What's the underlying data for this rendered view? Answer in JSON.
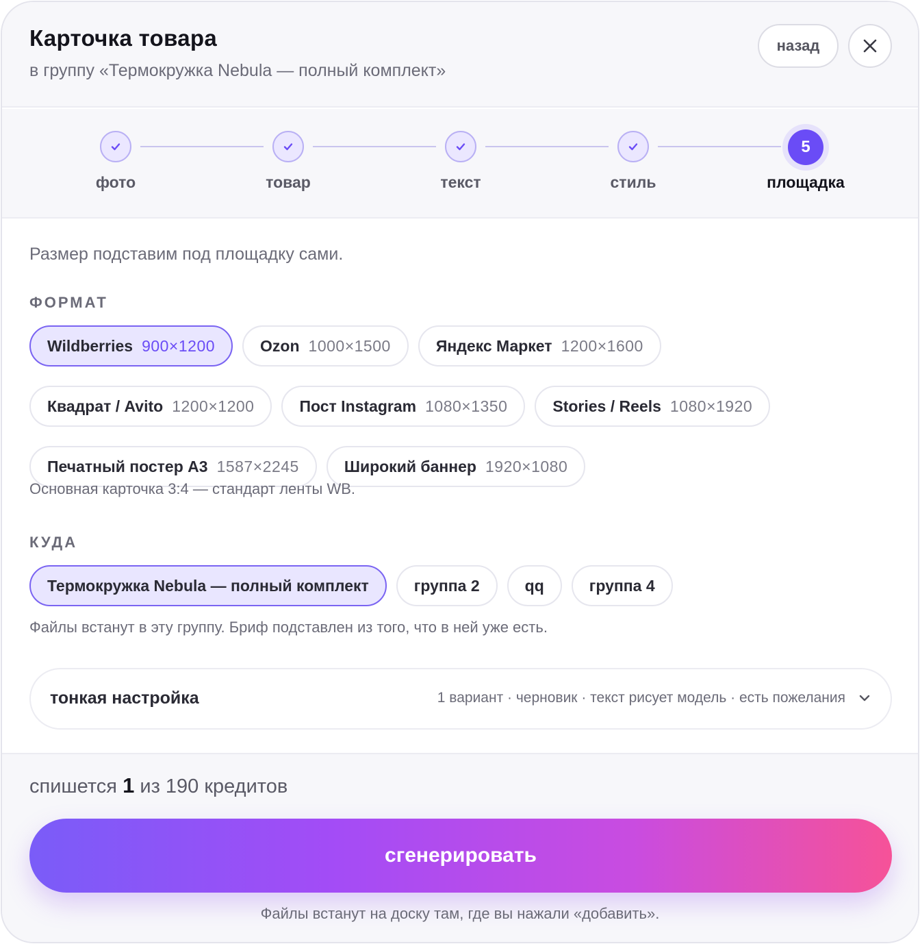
{
  "header": {
    "title": "Карточка товара",
    "subtitle": "в группу «Термокружка Nebula — полный комплект»",
    "back_label": "назад",
    "close_icon": "close-icon"
  },
  "stepper": {
    "steps": [
      {
        "label": "фото",
        "state": "done"
      },
      {
        "label": "товар",
        "state": "done"
      },
      {
        "label": "текст",
        "state": "done"
      },
      {
        "label": "стиль",
        "state": "done"
      },
      {
        "label": "площадка",
        "state": "active",
        "number": "5"
      }
    ]
  },
  "hint": "Размер подставим под площадку сами.",
  "format": {
    "title": "ФОРМАТ",
    "options": [
      {
        "name": "Wildberries",
        "size": "900×1200",
        "selected": true
      },
      {
        "name": "Ozon",
        "size": "1000×1500",
        "selected": false
      },
      {
        "name": "Яндекс Маркет",
        "size": "1200×1600",
        "selected": false
      },
      {
        "name": "Квадрат / Avito",
        "size": "1200×1200",
        "selected": false
      },
      {
        "name": "Пост Instagram",
        "size": "1080×1350",
        "selected": false
      },
      {
        "name": "Stories / Reels",
        "size": "1080×1920",
        "selected": false
      },
      {
        "name": "Печатный постер A3",
        "size": "1587×2245",
        "selected": false
      },
      {
        "name": "Широкий баннер",
        "size": "1920×1080",
        "selected": false
      }
    ],
    "note": "Основная карточка 3:4 — стандарт ленты WB."
  },
  "target": {
    "title": "КУДА",
    "options": [
      {
        "name": "Термокружка Nebula — полный комплект",
        "selected": true
      },
      {
        "name": "группа 2",
        "selected": false
      },
      {
        "name": "qq",
        "selected": false
      },
      {
        "name": "группа 4",
        "selected": false
      }
    ],
    "note": "Файлы встанут в эту группу. Бриф подставлен из того, что в ней уже есть."
  },
  "fine_tuning": {
    "label": "тонкая настройка",
    "summary": "1 вариант · черновик · текст рисует модель · есть пожелания"
  },
  "footer": {
    "credits_prefix": "спишется",
    "credits_amount": "1",
    "credits_suffix": "из 190 кредитов",
    "generate_label": "сгенерировать",
    "note": "Файлы встанут на доску там, где вы нажали «добавить»."
  },
  "colors": {
    "accent": "#6a4cf6",
    "gradient_start": "#7a5cf8",
    "gradient_end": "#f65298"
  }
}
